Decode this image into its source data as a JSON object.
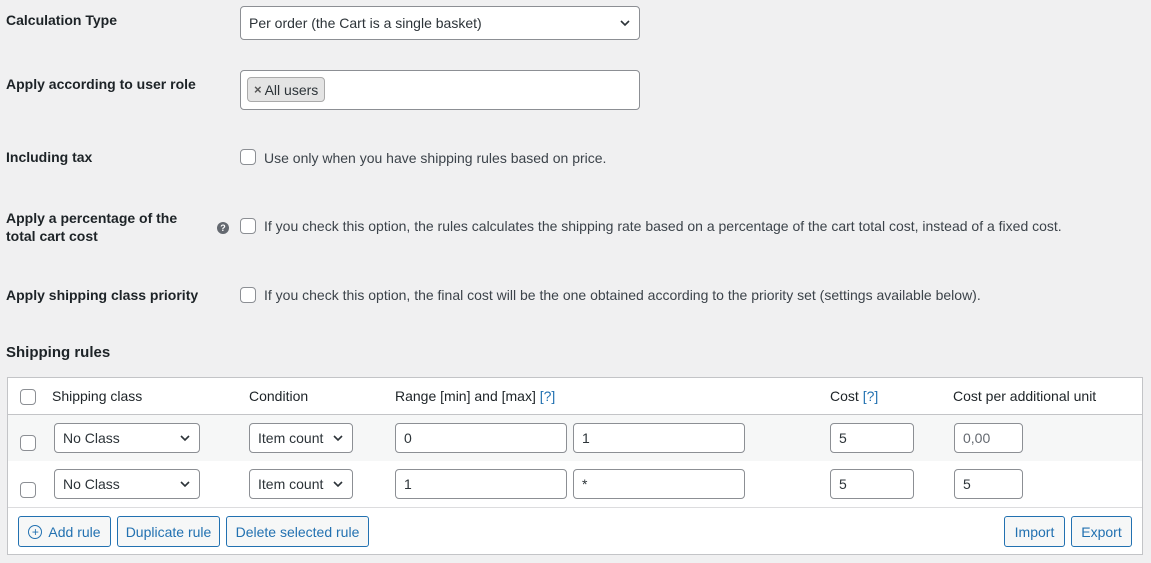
{
  "calculation_type": {
    "label": "Calculation Type",
    "value": "Per order (the Cart is a single basket)"
  },
  "user_role": {
    "label": "Apply according to user role",
    "tag_remove": "×",
    "tag": "All users"
  },
  "including_tax": {
    "label": "Including tax",
    "description": "Use only when you have shipping rules based on price."
  },
  "percentage": {
    "label_line1": "Apply a percentage of the",
    "label_line2": "total cart cost",
    "help_icon": "?",
    "description": "If you check this option, the rules calculates the shipping rate based on a percentage of the cart total cost, instead of a fixed cost."
  },
  "class_priority": {
    "label": "Apply shipping class priority",
    "description": "If you check this option, the final cost will be the one obtained according to the priority set (settings available below)."
  },
  "shipping_rules": {
    "title": "Shipping rules",
    "columns": {
      "shipping_class": "Shipping class",
      "condition": "Condition",
      "range": "Range [min] and [max]",
      "range_help": "[?]",
      "cost": "Cost",
      "cost_help": "[?]",
      "cost_per_unit": "Cost per additional unit"
    },
    "rows": [
      {
        "shipping_class": "No Class",
        "condition": "Item count",
        "min": "0",
        "max": "1",
        "cost": "5",
        "cost_per_unit_placeholder": "0,00",
        "cost_per_unit": ""
      },
      {
        "shipping_class": "No Class",
        "condition": "Item count",
        "min": "1",
        "max": "*",
        "cost": "5",
        "cost_per_unit_placeholder": "",
        "cost_per_unit": "5"
      }
    ],
    "buttons": {
      "add_rule_icon": "+",
      "add_rule": "Add rule",
      "duplicate_rule": "Duplicate rule",
      "delete_selected": "Delete selected rule",
      "import": "Import",
      "export": "Export"
    }
  },
  "colors": {
    "background": "#f0f0f1",
    "accent": "#2271b1",
    "border": "#8c8f94"
  }
}
